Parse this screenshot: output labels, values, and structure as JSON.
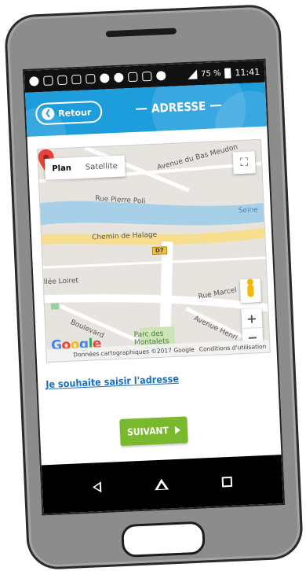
{
  "status_bar": {
    "battery": "75 %",
    "time": "11:41"
  },
  "header": {
    "back_label": "Retour",
    "title": "ADRESSE"
  },
  "map": {
    "tabs": [
      {
        "label": "Plan",
        "active": true
      },
      {
        "label": "Satellite",
        "active": false
      }
    ],
    "labels": {
      "street_1": "Avenue du Bas Meudon",
      "street_2": "Rue Pierre Poli",
      "river": "Seine",
      "street_3": "Chemin de Halage",
      "road_shield": "D7",
      "street_4": "Rue Marcel",
      "street_5": "Allée Loiret",
      "street_6": "Boulevard",
      "park": "Parc des Montalets",
      "street_7": "Avenue Henri"
    },
    "google_logo": "Google",
    "attribution": {
      "data": "Données cartographiques ©2017 Google",
      "terms": "Conditions d'utilisation"
    },
    "colors": {
      "water": "#a7cfe8",
      "road_major": "#f7de8e",
      "road": "#ffffff",
      "land": "#e7e4df",
      "park": "#cde4b8",
      "marker": "#e8413a"
    }
  },
  "manual_address_link": "Je souhaite saisir l'adresse",
  "next_button": "SUIVANT",
  "colors": {
    "header": "#1e9ddc",
    "next_button": "#7ab82e",
    "link": "#1a70c0"
  }
}
